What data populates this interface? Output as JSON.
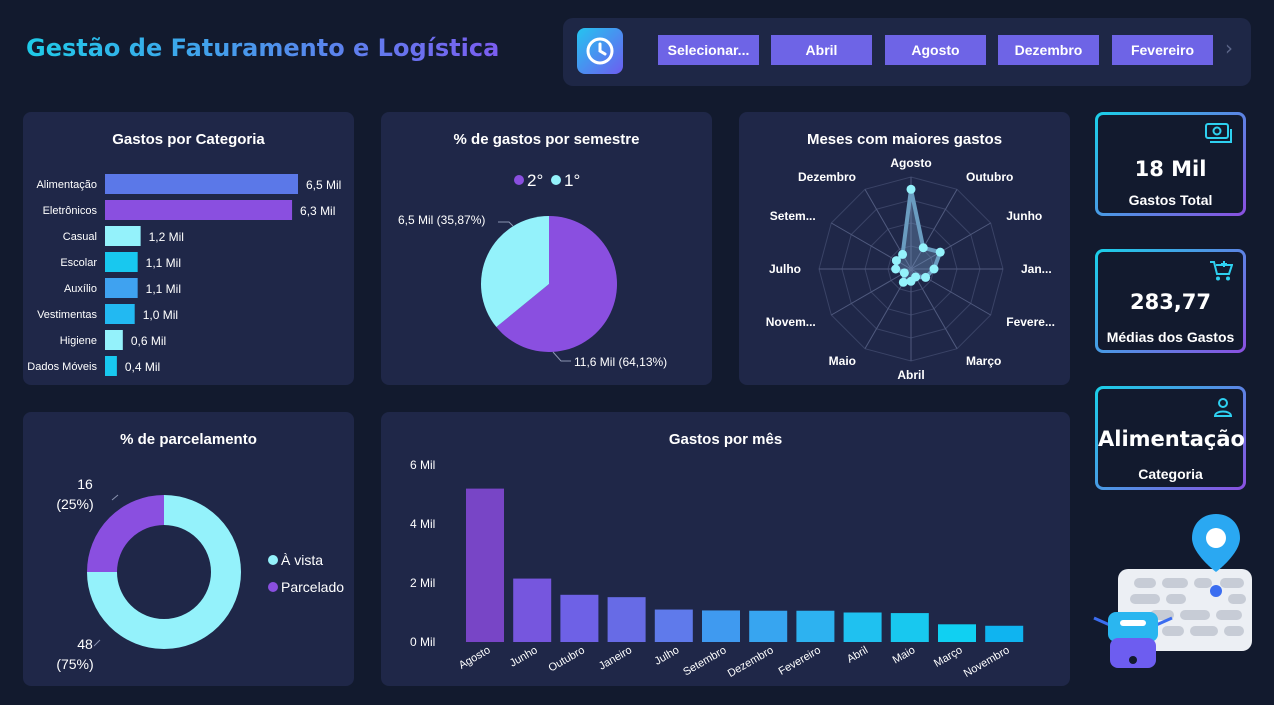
{
  "header": {
    "title": "Gestão de Faturamento e Logística",
    "months": [
      "Selecionar...",
      "Abril",
      "Agosto",
      "Dezembro",
      "Fevereiro"
    ],
    "next_glyph": "›"
  },
  "kpis": [
    {
      "value": "18 Mil",
      "label": "Gastos Total",
      "icon": "money-icon"
    },
    {
      "value": "283,77",
      "label": "Médias dos Gastos",
      "icon": "cart-icon"
    },
    {
      "value": "Alimentação",
      "label": "Categoria",
      "icon": "user-icon"
    }
  ],
  "colors": {
    "background": "#121a2e",
    "card": "#1f2748",
    "purple": "#8a4fe0",
    "cyan": "#94f2fb",
    "blue": "#5b78e8"
  },
  "chart_data": [
    {
      "type": "bar",
      "orientation": "horizontal",
      "title": "Gastos por Categoria",
      "categories": [
        "Alimentação",
        "Eletrônicos",
        "Casual",
        "Escolar",
        "Auxílio",
        "Vestimentas",
        "Higiene",
        "Dados Móveis"
      ],
      "values": [
        6.5,
        6.3,
        1.2,
        1.1,
        1.1,
        1.0,
        0.6,
        0.4
      ],
      "labels": [
        "6,5 Mil",
        "6,3 Mil",
        "1,2 Mil",
        "1,1 Mil",
        "1,1 Mil",
        "1,0 Mil",
        "0,6 Mil",
        "0,4 Mil"
      ],
      "colors": [
        "#5b78e8",
        "#8a4fe0",
        "#94f2fb",
        "#18c8ef",
        "#3fa2f0",
        "#22b9f2",
        "#94f2fb",
        "#18c8ef"
      ],
      "xlim": [
        0,
        6.5
      ]
    },
    {
      "type": "pie",
      "title": "% de gastos por semestre",
      "legend": [
        "2°",
        "1°"
      ],
      "legend_position": "top",
      "slices": [
        {
          "name": "2°",
          "value": 11.6,
          "label": "11,6 Mil (64,13%)",
          "color": "#8a4fe0"
        },
        {
          "name": "1°",
          "value": 6.5,
          "label": "6,5 Mil (35,87%)",
          "color": "#94f2fb"
        }
      ]
    },
    {
      "type": "radar",
      "title": "Meses com maiores gastos",
      "axes": [
        "Agosto",
        "Outubro",
        "Junho",
        "Jan...",
        "Fevere...",
        "Março",
        "Abril",
        "Maio",
        "Novem...",
        "Julho",
        "Setem...",
        "Dezembro"
      ],
      "values": [
        5.2,
        1.6,
        2.2,
        1.5,
        1.1,
        0.6,
        0.8,
        1.0,
        0.5,
        1.0,
        1.1,
        1.1
      ],
      "max": 6
    },
    {
      "type": "donut",
      "title": "% de parcelamento",
      "legend": [
        "À vista",
        "Parcelado"
      ],
      "legend_position": "right",
      "slices": [
        {
          "name": "À vista",
          "value": 48,
          "count_label": "48",
          "pct_label": "(75%)",
          "color": "#94f2fb"
        },
        {
          "name": "Parcelado",
          "value": 16,
          "count_label": "16",
          "pct_label": "(25%)",
          "color": "#8a4fe0"
        }
      ]
    },
    {
      "type": "bar",
      "title": "Gastos por mês",
      "categories": [
        "Agosto",
        "Junho",
        "Outubro",
        "Janeiro",
        "Julho",
        "Setembro",
        "Dezembro",
        "Fevereiro",
        "Abril",
        "Maio",
        "Março",
        "Novembro"
      ],
      "values": [
        5.2,
        2.15,
        1.6,
        1.52,
        1.1,
        1.07,
        1.06,
        1.06,
        1.0,
        0.98,
        0.6,
        0.55
      ],
      "colors": [
        "#7845c6",
        "#7656de",
        "#6e61e6",
        "#676be6",
        "#5f7aeb",
        "#3f9af0",
        "#37a5f0",
        "#2db2f0",
        "#1fc1f0",
        "#18c8ef",
        "#10d0f2",
        "#0fb4f0"
      ],
      "ytick_labels": [
        "0 Mil",
        "2 Mil",
        "4 Mil",
        "6 Mil"
      ],
      "ylim": [
        0,
        6
      ]
    }
  ]
}
